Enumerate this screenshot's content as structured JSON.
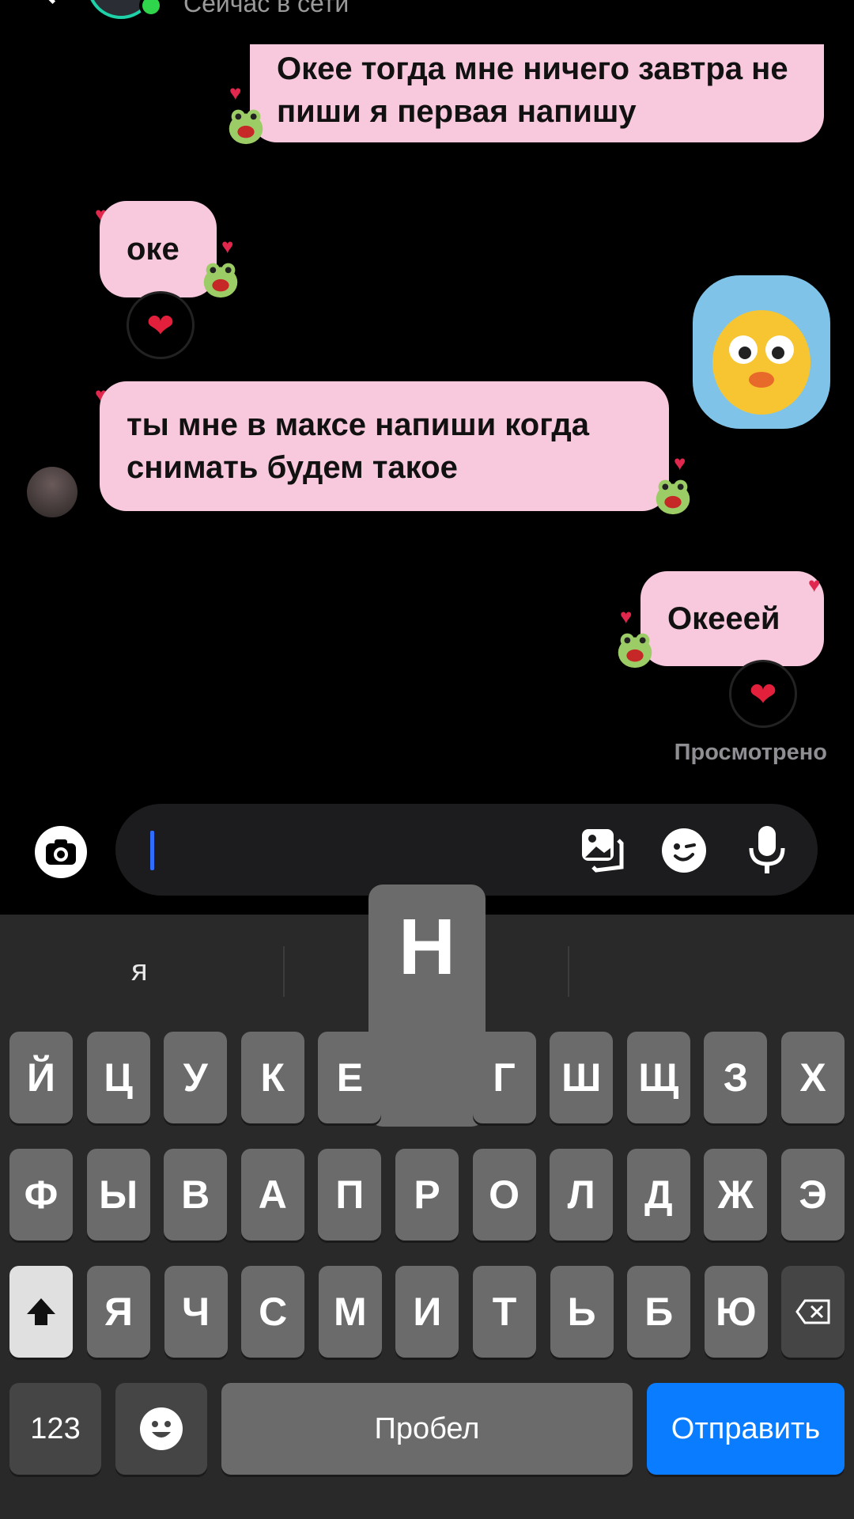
{
  "header": {
    "status": "Сейчас в сети"
  },
  "messages": [
    {
      "text": "Окее тогда мне ничего завтра не пиши я первая напишу"
    },
    {
      "text": "оке",
      "reaction": "❤"
    },
    {
      "text": "ты мне в максе напиши когда снимать будем такое"
    },
    {
      "text": "Окееей",
      "reaction": "❤"
    }
  ],
  "seen_label": "Просмотрено",
  "composer": {
    "icons": [
      "camera-icon",
      "gallery-icon",
      "sticker-icon",
      "microphone-icon"
    ]
  },
  "keyboard": {
    "suggestion": "я",
    "popup_key": "Н",
    "row1": [
      "Й",
      "Ц",
      "У",
      "К",
      "Е",
      "Н",
      "Г",
      "Ш",
      "Щ",
      "З",
      "Х"
    ],
    "row2": [
      "Ф",
      "Ы",
      "В",
      "А",
      "П",
      "Р",
      "О",
      "Л",
      "Д",
      "Ж",
      "Э"
    ],
    "row3": [
      "Я",
      "Ч",
      "С",
      "М",
      "И",
      "Т",
      "Ь",
      "Б",
      "Ю"
    ],
    "numbers_label": "123",
    "space_label": "Пробел",
    "send_label": "Отправить"
  },
  "colors": {
    "bubble": "#f8c8dc",
    "accent": "#0a7cff",
    "online": "#2fd64b"
  }
}
